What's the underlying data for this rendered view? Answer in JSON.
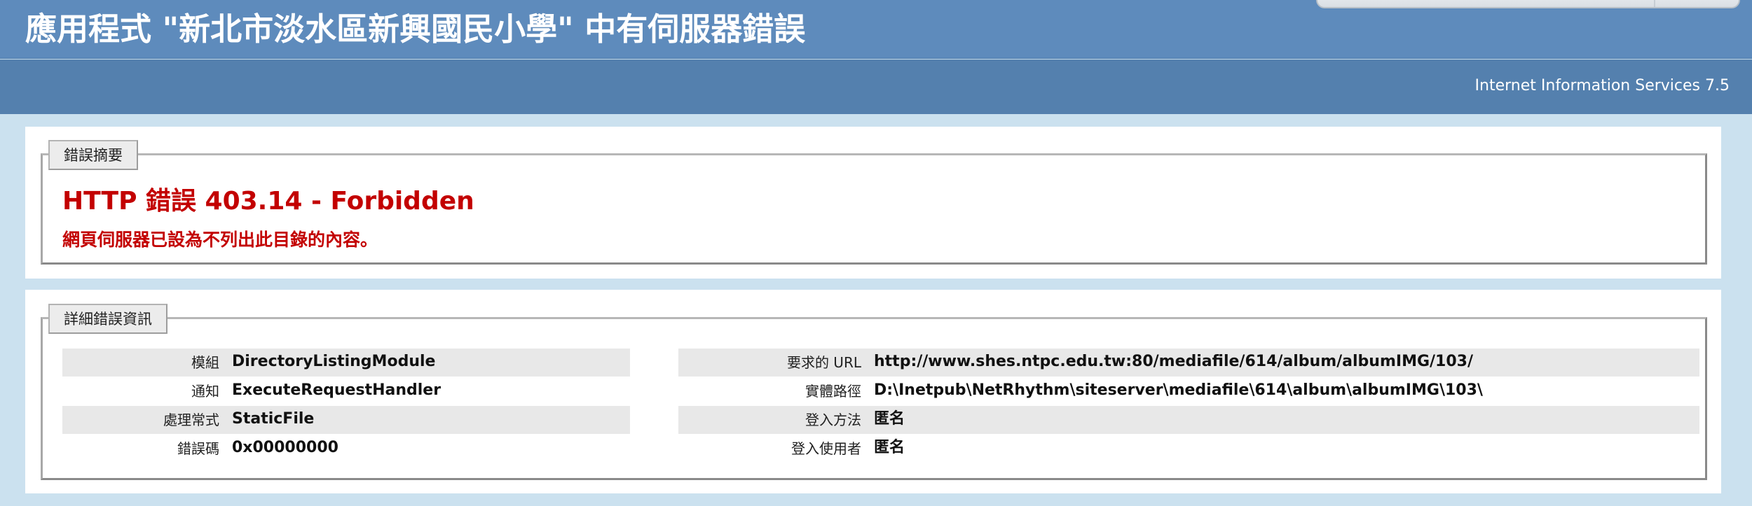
{
  "header": {
    "title": "應用程式 \"新北市淡水區新興國民小學\" 中有伺服器錯誤",
    "server_version": "Internet Information Services 7.5"
  },
  "summary": {
    "legend": "錯誤摘要",
    "error_title": "HTTP 錯誤 403.14 - Forbidden",
    "error_message": "網頁伺服器已設為不列出此目錄的內容。"
  },
  "details": {
    "legend": "詳細錯誤資訊",
    "left": [
      {
        "label": "模組",
        "value": "DirectoryListingModule"
      },
      {
        "label": "通知",
        "value": "ExecuteRequestHandler"
      },
      {
        "label": "處理常式",
        "value": "StaticFile"
      },
      {
        "label": "錯誤碼",
        "value": "0x00000000"
      }
    ],
    "right": [
      {
        "label": "要求的 URL",
        "value": "http://www.shes.ntpc.edu.tw:80/mediafile/614/album/albumIMG/103/"
      },
      {
        "label": "實體路徑",
        "value": "D:\\Inetpub\\NetRhythm\\siteserver\\mediafile\\614\\album\\albumIMG\\103\\"
      },
      {
        "label": "登入方法",
        "value": "匿名"
      },
      {
        "label": "登入使用者",
        "value": "匿名"
      }
    ]
  },
  "colors": {
    "header_background": "#5e8bbc",
    "subheader_background": "#5480ae",
    "page_background": "#cbe1ef",
    "error_red": "#c30000",
    "row_shade": "#e8e8e8"
  }
}
